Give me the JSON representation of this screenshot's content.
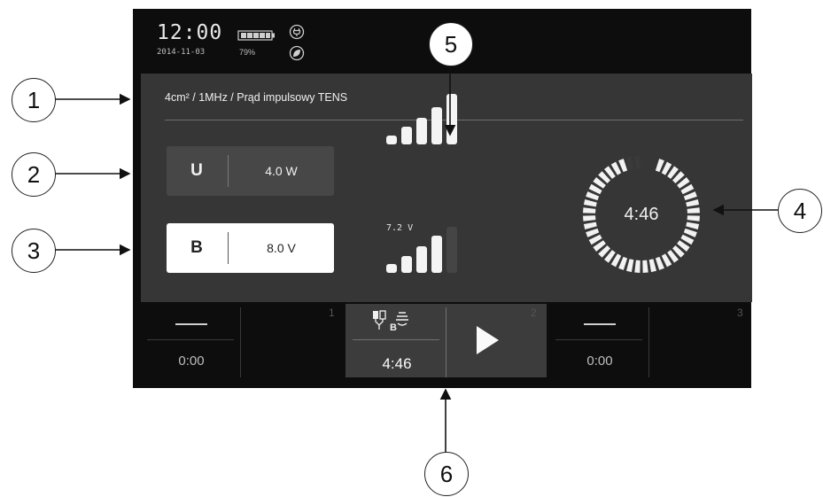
{
  "status": {
    "time": "12:00",
    "date": "2014-11-03",
    "battery_percent": "79%",
    "battery_icon": "battery-icon",
    "plug_icon": "plug-icon",
    "leaf_icon": "eco-leaf-icon"
  },
  "panel": {
    "title": "4cm² / 1MHz / Prąd impulsowy TENS",
    "param_u": {
      "label": "U",
      "value": "4.0 W"
    },
    "param_b": {
      "label": "B",
      "value": "8.0 V",
      "selected": true
    },
    "voltage_label": "7.2 V",
    "level_u": {
      "filled": 5,
      "total": 5
    },
    "level_b": {
      "filled": 4,
      "total": 5
    },
    "timer": "4:46",
    "timer_progress": 0.95
  },
  "channels": [
    {
      "number": "1",
      "time": "0:00"
    },
    {
      "number": "2",
      "time": "4:46",
      "electrode_label": "B",
      "active": true
    },
    {
      "number": "3",
      "time": "0:00"
    }
  ],
  "callouts": [
    "1",
    "2",
    "3",
    "4",
    "5",
    "6"
  ],
  "colors": {
    "screen_bg": "#0d0d0d",
    "panel_bg": "#363636",
    "active_channel_bg": "#3c3c3c",
    "foreground": "#f0f0f0"
  }
}
